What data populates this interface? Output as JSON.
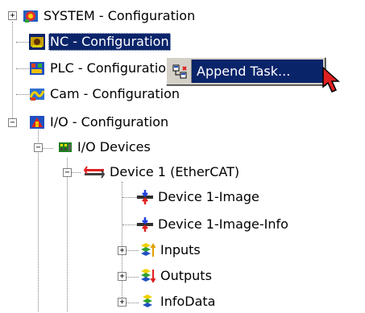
{
  "tree": {
    "system": "SYSTEM - Configuration",
    "nc": "NC - Configuration",
    "plc": "PLC - Configuration",
    "cam": "Cam - Configuration",
    "io": "I/O - Configuration",
    "io_devices": "I/O Devices",
    "device1": "Device 1 (EtherCAT)",
    "device1_image": "Device 1-Image",
    "device1_image_info": "Device 1-Image-Info",
    "inputs": "Inputs",
    "outputs": "Outputs",
    "infodata": "InfoData",
    "expander_plus": "+",
    "expander_minus": "−"
  },
  "context_menu": {
    "append_task": "Append Task..."
  },
  "colors": {
    "selection": "#0a246a",
    "menu_bg": "#d4d0c8"
  },
  "icons": [
    "system-config-icon",
    "nc-config-icon",
    "plc-config-icon",
    "cam-config-icon",
    "io-config-icon",
    "io-devices-icon",
    "ethercat-device-icon",
    "process-image-icon",
    "inputs-icon",
    "outputs-icon",
    "infodata-icon",
    "append-task-icon",
    "mouse-cursor-icon"
  ]
}
